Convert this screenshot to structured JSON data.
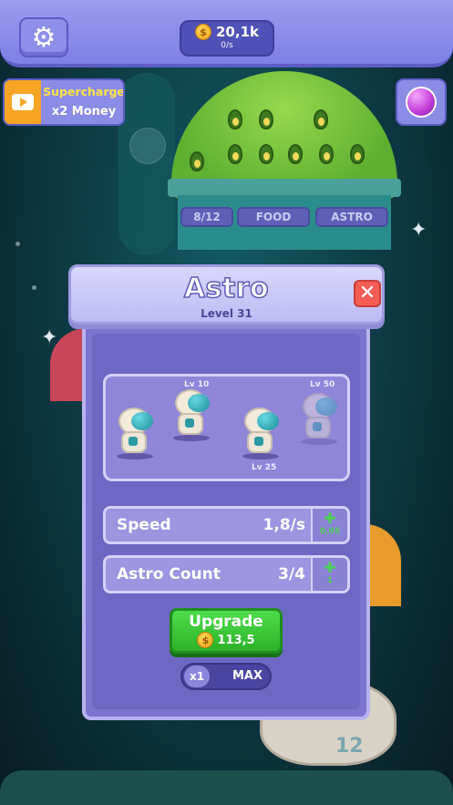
{
  "topbar": {
    "money": "20,1k",
    "money_rate": "0/s"
  },
  "supercharge": {
    "title": "Supercharge",
    "subtitle": "x2 Money"
  },
  "building": {
    "capacity": "8/12",
    "tabs": [
      "FOOD",
      "ASTRO"
    ]
  },
  "dialog": {
    "title": "Astro",
    "level": "Level 31",
    "roster_levels": [
      "Lv 10",
      "Lv 25",
      "Lv 50"
    ],
    "stats": [
      {
        "label": "Speed",
        "value": "1,8/s",
        "increment": "0,05"
      },
      {
        "label": "Astro Count",
        "value": "3/4",
        "increment": "1"
      }
    ],
    "upgrade": {
      "label": "Upgrade",
      "cost": "113,5"
    },
    "multiplier": {
      "selected": "x1",
      "other": "MAX"
    }
  },
  "decor": {
    "rocket_number": "12"
  },
  "icons": {
    "settings": "gear-icon",
    "coin": "coin-icon",
    "ad": "play-video-icon",
    "planet": "planet-icon",
    "close": "close-icon"
  }
}
